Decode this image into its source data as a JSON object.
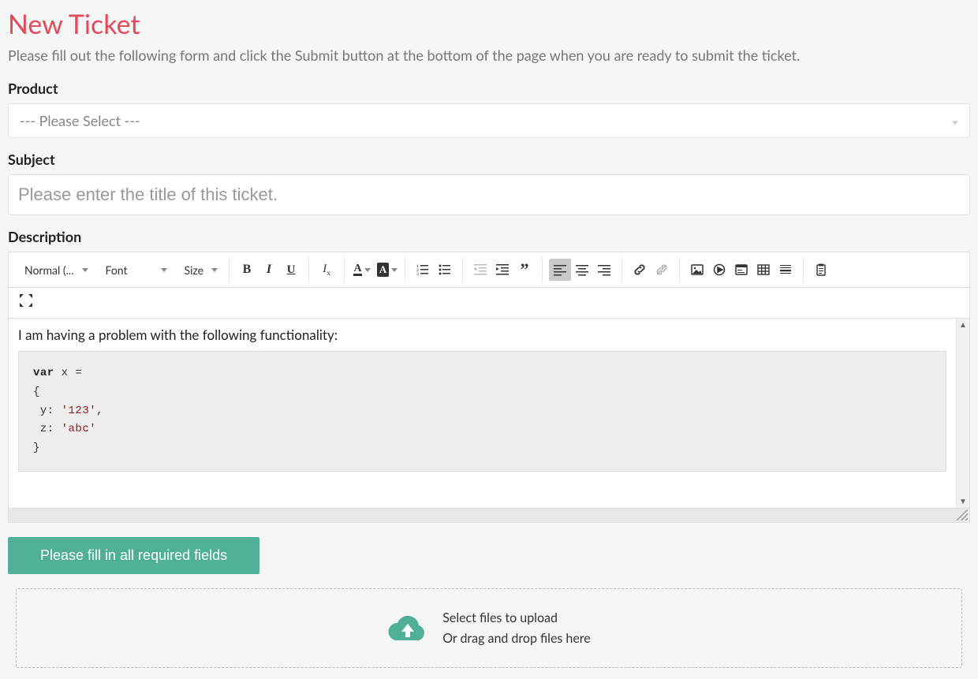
{
  "page": {
    "title": "New Ticket",
    "instructions": "Please fill out the following form and click the Submit button at the bottom of the page when you are ready to submit the ticket."
  },
  "labels": {
    "product": "Product",
    "subject": "Subject",
    "description": "Description"
  },
  "product": {
    "placeholder": "--- Please Select ---",
    "value": ""
  },
  "subject": {
    "placeholder": "Please enter the title of this ticket.",
    "value": ""
  },
  "editor": {
    "toolbar": {
      "format": "Normal (...",
      "font": "Font",
      "size": "Size"
    },
    "content": {
      "intro": "I am having a problem with the following functionality:",
      "code": {
        "l1_kw": "var",
        "l1_rest": " x =",
        "l2": "{",
        "l3_label": " y: ",
        "l3_str": "'123'",
        "l3_tail": ",",
        "l4_label": " z: ",
        "l4_str": "'abc'",
        "l5": "}"
      }
    }
  },
  "submit": {
    "label": "Please fill in all required fields"
  },
  "upload": {
    "line1": "Select files to upload",
    "line2": "Or drag and drop files here"
  },
  "colors": {
    "accent_red": "#e64759",
    "accent_green": "#4fb095"
  }
}
